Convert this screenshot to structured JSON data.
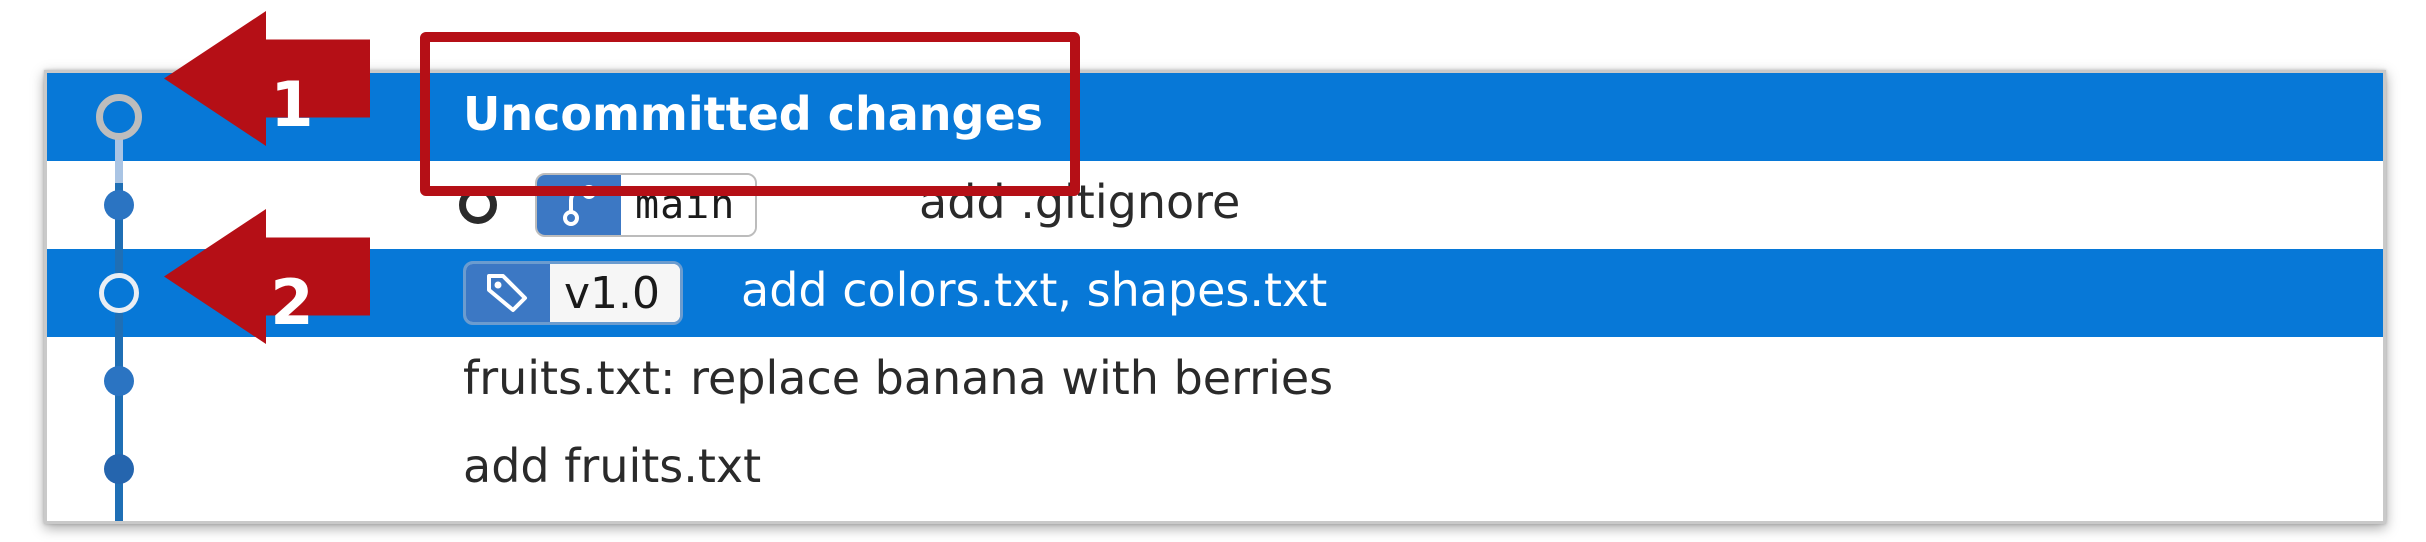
{
  "graph": {
    "rows": [
      {
        "message": "Uncommitted changes",
        "selected": true,
        "bold": true,
        "node": "hollow-grey-icon"
      },
      {
        "message": "add .gitignore",
        "selected": false,
        "bold": false,
        "node": "commit-dot-icon",
        "ref": {
          "type": "branch",
          "label": "main",
          "icon": "branch-icon"
        },
        "head": true
      },
      {
        "message": "add colors.txt, shapes.txt",
        "selected": true,
        "bold": false,
        "node": "hollow-white-icon",
        "ref": {
          "type": "tag",
          "label": "v1.0",
          "icon": "tag-icon"
        }
      },
      {
        "message": "fruits.txt: replace banana with berries",
        "selected": false,
        "bold": false,
        "node": "commit-dot-icon"
      },
      {
        "message": "add fruits.txt",
        "selected": false,
        "bold": false,
        "node": "commit-dot-icon"
      }
    ]
  },
  "annotations": {
    "arrow1_number": "1",
    "arrow2_number": "2",
    "color": "#b50f16"
  },
  "colors": {
    "selection": "#0778d7",
    "graph": "#1f6fb5"
  }
}
